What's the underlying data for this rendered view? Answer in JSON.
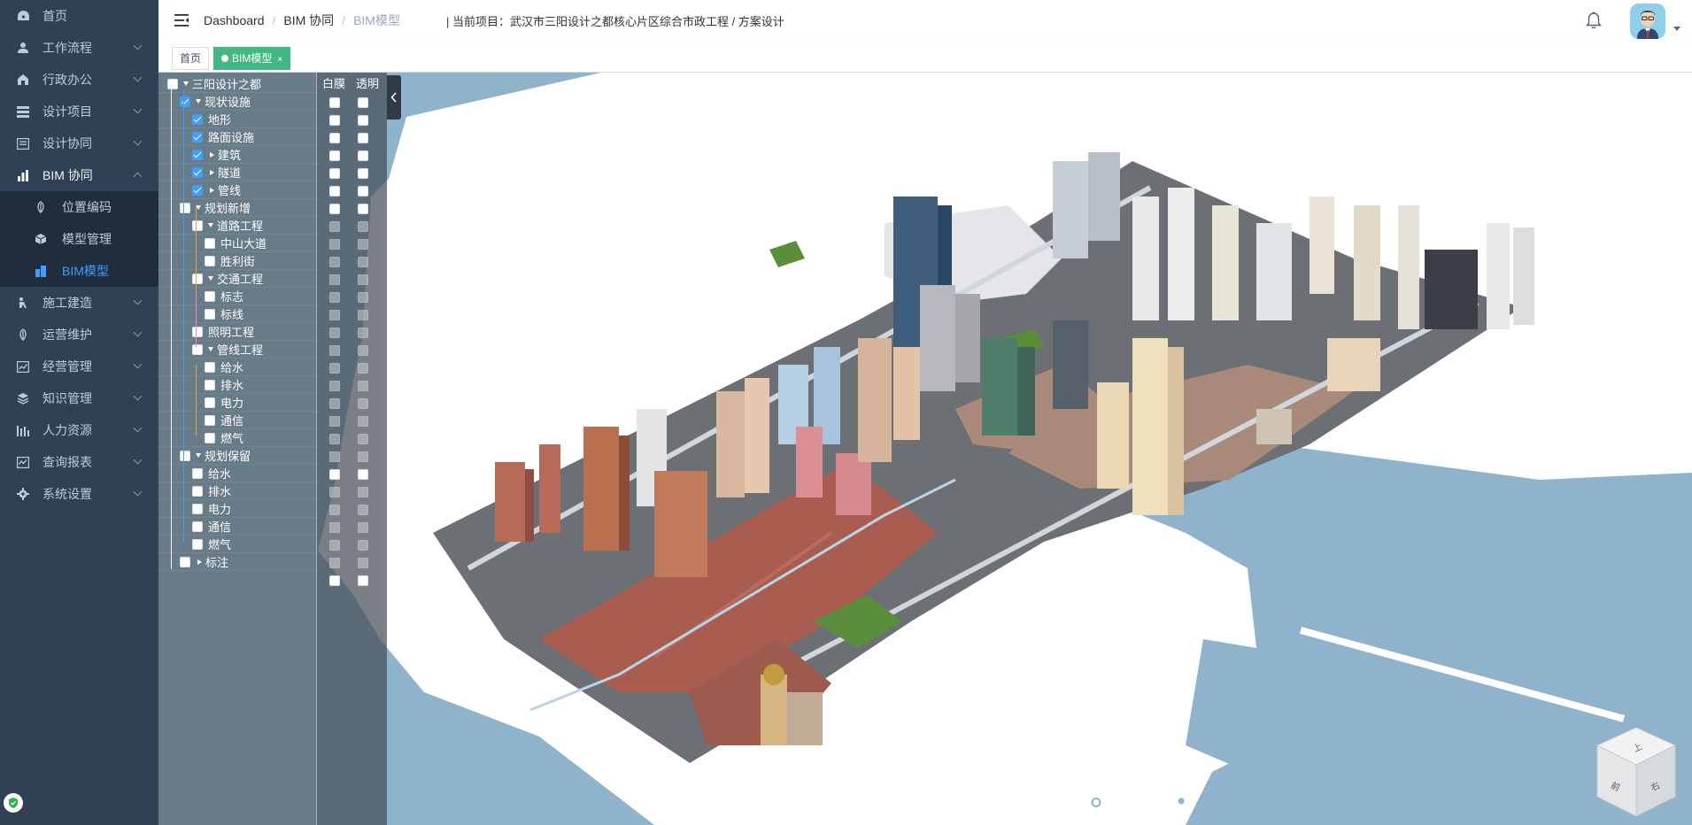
{
  "sidebar": {
    "items": [
      {
        "label": "首页",
        "icon": "dashboard-icon",
        "has_arrow": false
      },
      {
        "label": "工作流程",
        "icon": "user-icon",
        "has_arrow": true
      },
      {
        "label": "行政办公",
        "icon": "office-icon",
        "has_arrow": true
      },
      {
        "label": "设计项目",
        "icon": "list-icon",
        "has_arrow": true
      },
      {
        "label": "设计协同",
        "icon": "document-icon",
        "has_arrow": true
      },
      {
        "label": "BIM 协同",
        "icon": "chart-icon",
        "has_arrow": true,
        "open": true
      }
    ],
    "submenu": [
      {
        "label": "位置编码",
        "icon": "leaf-icon"
      },
      {
        "label": "模型管理",
        "icon": "cube-icon"
      },
      {
        "label": "BIM模型",
        "icon": "building-icon",
        "active": true
      }
    ],
    "items_after": [
      {
        "label": "施工建造",
        "icon": "worker-icon"
      },
      {
        "label": "运营维护",
        "icon": "leaf-icon"
      },
      {
        "label": "经营管理",
        "icon": "trend-icon"
      },
      {
        "label": "知识管理",
        "icon": "layers-icon"
      },
      {
        "label": "人力资源",
        "icon": "bars-icon"
      },
      {
        "label": "查询报表",
        "icon": "report-icon"
      },
      {
        "label": "系统设置",
        "icon": "gear-icon"
      }
    ]
  },
  "header": {
    "breadcrumb": [
      "Dashboard",
      "BIM 协同",
      "BIM模型"
    ],
    "project_label": "| 当前项目：",
    "project_name": "武汉市三阳设计之都核心片区综合市政工程 / 方案设计"
  },
  "tags": [
    {
      "label": "首页",
      "active": false
    },
    {
      "label": "BIM模型",
      "active": true,
      "close": "×"
    }
  ],
  "layer_tree": {
    "mode_headers": [
      "白膜",
      "透明"
    ],
    "rows": [
      {
        "label": "三阳设计之都",
        "indent": 0,
        "expand": "down",
        "checked": false
      },
      {
        "label": "现状设施",
        "indent": 1,
        "expand": "down",
        "checked": true
      },
      {
        "label": "地形",
        "indent": 2,
        "expand": "none",
        "checked": true
      },
      {
        "label": "路面设施",
        "indent": 2,
        "expand": "none",
        "checked": true
      },
      {
        "label": "建筑",
        "indent": 2,
        "expand": "right",
        "checked": true
      },
      {
        "label": "隧道",
        "indent": 2,
        "expand": "right",
        "checked": true
      },
      {
        "label": "管线",
        "indent": 2,
        "expand": "right",
        "checked": true
      },
      {
        "label": "规划新增",
        "indent": 1,
        "expand": "down",
        "checked": false
      },
      {
        "label": "道路工程",
        "indent": 2,
        "expand": "down",
        "checked": false
      },
      {
        "label": "中山大道",
        "indent": 3,
        "expand": "none",
        "checked": false
      },
      {
        "label": "胜利街",
        "indent": 3,
        "expand": "none",
        "checked": false
      },
      {
        "label": "交通工程",
        "indent": 2,
        "expand": "down",
        "checked": false
      },
      {
        "label": "标志",
        "indent": 3,
        "expand": "none",
        "checked": false
      },
      {
        "label": "标线",
        "indent": 3,
        "expand": "none",
        "checked": false
      },
      {
        "label": "照明工程",
        "indent": 2,
        "expand": "none",
        "checked": false
      },
      {
        "label": "管线工程",
        "indent": 2,
        "expand": "down",
        "checked": false
      },
      {
        "label": "给水",
        "indent": 3,
        "expand": "none",
        "checked": false
      },
      {
        "label": "排水",
        "indent": 3,
        "expand": "none",
        "checked": false
      },
      {
        "label": "电力",
        "indent": 3,
        "expand": "none",
        "checked": false
      },
      {
        "label": "通信",
        "indent": 3,
        "expand": "none",
        "checked": false
      },
      {
        "label": "燃气",
        "indent": 3,
        "expand": "none",
        "checked": false
      },
      {
        "label": "规划保留",
        "indent": 1,
        "expand": "down",
        "checked": false
      },
      {
        "label": "给水",
        "indent": 2,
        "expand": "none",
        "checked": false
      },
      {
        "label": "排水",
        "indent": 2,
        "expand": "none",
        "checked": false
      },
      {
        "label": "电力",
        "indent": 2,
        "expand": "none",
        "checked": false
      },
      {
        "label": "通信",
        "indent": 2,
        "expand": "none",
        "checked": false
      },
      {
        "label": "燃气",
        "indent": 2,
        "expand": "none",
        "checked": false
      },
      {
        "label": "标注",
        "indent": 1,
        "expand": "right",
        "checked": false
      }
    ]
  },
  "toolbar": {
    "tools": [
      "list-icon",
      "camera-icon",
      "fullscreen-icon",
      "settings-icon"
    ]
  },
  "navcube": {
    "faces": [
      "上",
      "前",
      "右"
    ]
  },
  "colors": {
    "sidebar_bg": "#304156",
    "submenu_bg": "#1f2d3d",
    "accent": "#409eff",
    "tag_active": "#42b983",
    "water": "#8eb3cb"
  }
}
